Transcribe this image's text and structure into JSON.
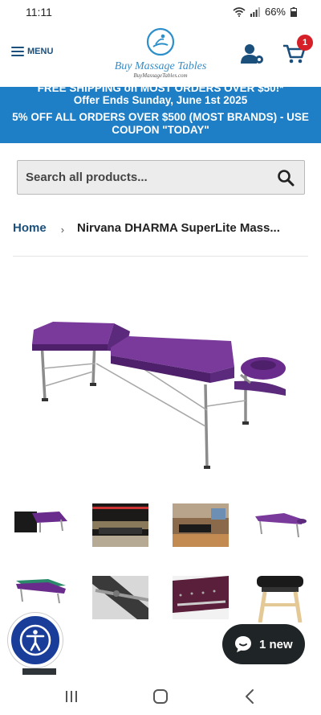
{
  "status_bar": {
    "time": "11:11",
    "battery": "66%"
  },
  "header": {
    "menu_label": "MENU",
    "logo_name": "Buy Massage Tables",
    "logo_url": "BuyMassageTables.com",
    "cart_count": "1"
  },
  "promo": {
    "line1": "FREE SHIPPING on MOST ORDERS OVER $50!*",
    "line2": "Offer Ends Sunday, June 1st 2025",
    "line3": "5% OFF ALL ORDERS OVER $500 (MOST BRANDS) - USE COUPON \"TODAY\""
  },
  "search": {
    "placeholder": "Search all products..."
  },
  "breadcrumb": {
    "home": "Home",
    "separator": "›",
    "current": "Nirvana DHARMA SuperLite Mass..."
  },
  "chat": {
    "label": "1 new"
  },
  "colors": {
    "brand_blue": "#1e7fc6",
    "navy": "#1b4f7c",
    "table_purple": "#6a2c8c",
    "badge_red": "#d61f26"
  },
  "icons": [
    "hamburger-icon",
    "user-settings-icon",
    "cart-icon",
    "search-icon",
    "accessibility-icon",
    "chat-bubble-icon",
    "recents-icon",
    "home-icon",
    "back-icon"
  ]
}
